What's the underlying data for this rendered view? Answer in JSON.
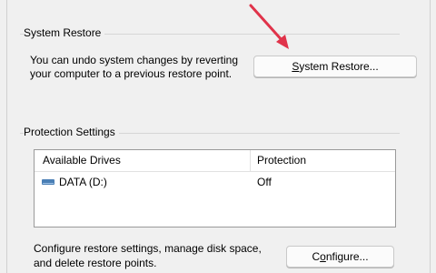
{
  "system_restore": {
    "group_title": "System Restore",
    "description_line1": "You can undo system changes by reverting",
    "description_line2": "your computer to a previous restore point.",
    "button_label_mnemonic": "S",
    "button_label_rest": "ystem Restore..."
  },
  "protection_settings": {
    "group_title": "Protection Settings",
    "columns": [
      "Available Drives",
      "Protection"
    ],
    "drives": [
      {
        "name": "DATA (D:)",
        "protection": "Off",
        "icon": "drive-icon"
      }
    ],
    "config_description_line1": "Configure restore settings, manage disk space,",
    "config_description_line2": "and delete restore points.",
    "configure_label_pre": "C",
    "configure_label_mnemonic": "o",
    "configure_label_rest": "nfigure..."
  },
  "colors": {
    "arrow": "#e0334a",
    "drive_icon": "#4a7fb5"
  }
}
